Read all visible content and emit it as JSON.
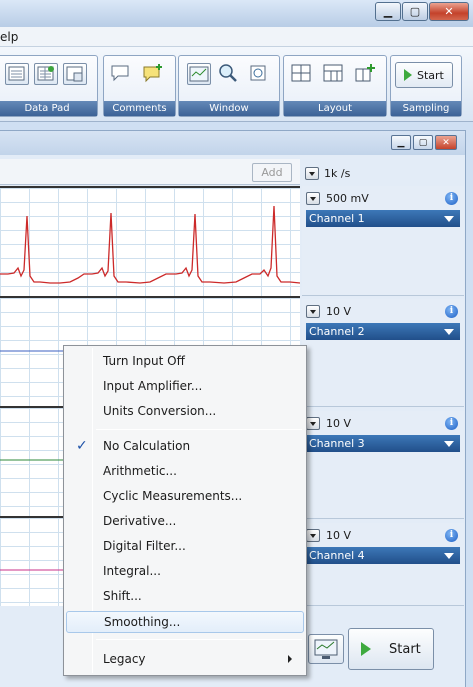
{
  "menubar": {
    "help_fragment": "elp"
  },
  "toolbar": {
    "groups": [
      {
        "label": "Data Pad"
      },
      {
        "label": "Comments"
      },
      {
        "label": "Window"
      },
      {
        "label": "Layout"
      },
      {
        "label": "Sampling"
      }
    ],
    "start_label": "Start"
  },
  "chart": {
    "add_label": "Add",
    "sample_rate": "1k /s",
    "channels": [
      {
        "range": "500 mV",
        "name": "Channel 1"
      },
      {
        "range": "10 V",
        "name": "Channel 2"
      },
      {
        "range": "10 V",
        "name": "Channel 3"
      },
      {
        "range": "10 V",
        "name": "Channel 4"
      }
    ],
    "trace_color": "#cc2a2a",
    "big_start_label": "Start"
  },
  "context_menu": {
    "items": [
      {
        "label": "Turn Input Off"
      },
      {
        "label": "Input Amplifier..."
      },
      {
        "label": "Units Conversion..."
      },
      {
        "label": "No Calculation",
        "checked": true
      },
      {
        "label": "Arithmetic..."
      },
      {
        "label": "Cyclic Measurements..."
      },
      {
        "label": "Derivative..."
      },
      {
        "label": "Digital Filter..."
      },
      {
        "label": "Integral..."
      },
      {
        "label": "Shift..."
      },
      {
        "label": "Smoothing...",
        "highlighted": true
      },
      {
        "label": "Legacy",
        "submenu": true
      }
    ]
  }
}
